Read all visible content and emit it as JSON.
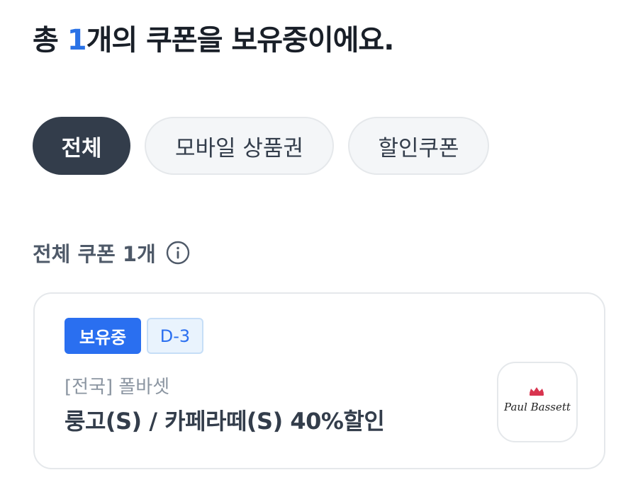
{
  "header": {
    "prefix": "총 ",
    "count": "1",
    "suffix": "개의 쿠폰을 보유중이에요."
  },
  "tabs": [
    {
      "label": "전체",
      "active": true
    },
    {
      "label": "모바일 상품권",
      "active": false
    },
    {
      "label": "할인쿠폰",
      "active": false
    }
  ],
  "section": {
    "title": "전체 쿠폰 1개",
    "info_icon": "info-circle-icon"
  },
  "coupon": {
    "status_badge": "보유중",
    "dday_badge": "D-3",
    "brand": "[전국] 폴바셋",
    "product": "룽고(S) / 카페라떼(S) 40%할인",
    "logo_icon": "paul-bassett-logo",
    "logo_text": "Paul Bassett"
  },
  "colors": {
    "accent": "#2a72e6",
    "active_tab": "#333d4b",
    "badge_blue": "#2a6ff0",
    "logo_crown": "#d8344f"
  }
}
